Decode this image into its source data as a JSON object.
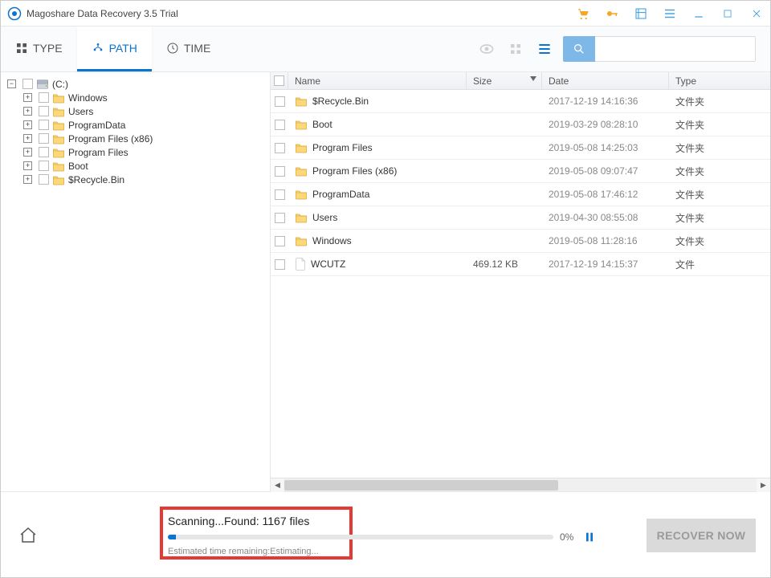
{
  "titlebar": {
    "title": "Magoshare Data Recovery 3.5 Trial"
  },
  "tabs": {
    "type": "TYPE",
    "path": "PATH",
    "time": "TIME"
  },
  "search": {
    "placeholder": ""
  },
  "tree": {
    "root": "(C:)",
    "items": [
      {
        "label": "Windows"
      },
      {
        "label": "Users"
      },
      {
        "label": "ProgramData"
      },
      {
        "label": "Program Files (x86)"
      },
      {
        "label": "Program Files"
      },
      {
        "label": "Boot"
      },
      {
        "label": "$Recycle.Bin"
      }
    ]
  },
  "list": {
    "headers": {
      "name": "Name",
      "size": "Size",
      "date": "Date",
      "type": "Type"
    },
    "rows": [
      {
        "name": "$Recycle.Bin",
        "size": "",
        "date": "2017-12-19 14:16:36",
        "type": "文件夹",
        "kind": "folder"
      },
      {
        "name": "Boot",
        "size": "",
        "date": "2019-03-29 08:28:10",
        "type": "文件夹",
        "kind": "folder"
      },
      {
        "name": "Program Files",
        "size": "",
        "date": "2019-05-08 14:25:03",
        "type": "文件夹",
        "kind": "folder"
      },
      {
        "name": "Program Files (x86)",
        "size": "",
        "date": "2019-05-08 09:07:47",
        "type": "文件夹",
        "kind": "folder"
      },
      {
        "name": "ProgramData",
        "size": "",
        "date": "2019-05-08 17:46:12",
        "type": "文件夹",
        "kind": "folder"
      },
      {
        "name": "Users",
        "size": "",
        "date": "2019-04-30 08:55:08",
        "type": "文件夹",
        "kind": "folder"
      },
      {
        "name": "Windows",
        "size": "",
        "date": "2019-05-08 11:28:16",
        "type": "文件夹",
        "kind": "folder"
      },
      {
        "name": "WCUTZ",
        "size": "469.12 KB",
        "date": "2017-12-19 14:15:37",
        "type": "文件",
        "kind": "file"
      }
    ]
  },
  "footer": {
    "scan_text": "Scanning...Found: 1167 files",
    "eta": "Estimated time remaining:Estimating...",
    "percent": "0%",
    "recover": "RECOVER NOW"
  }
}
